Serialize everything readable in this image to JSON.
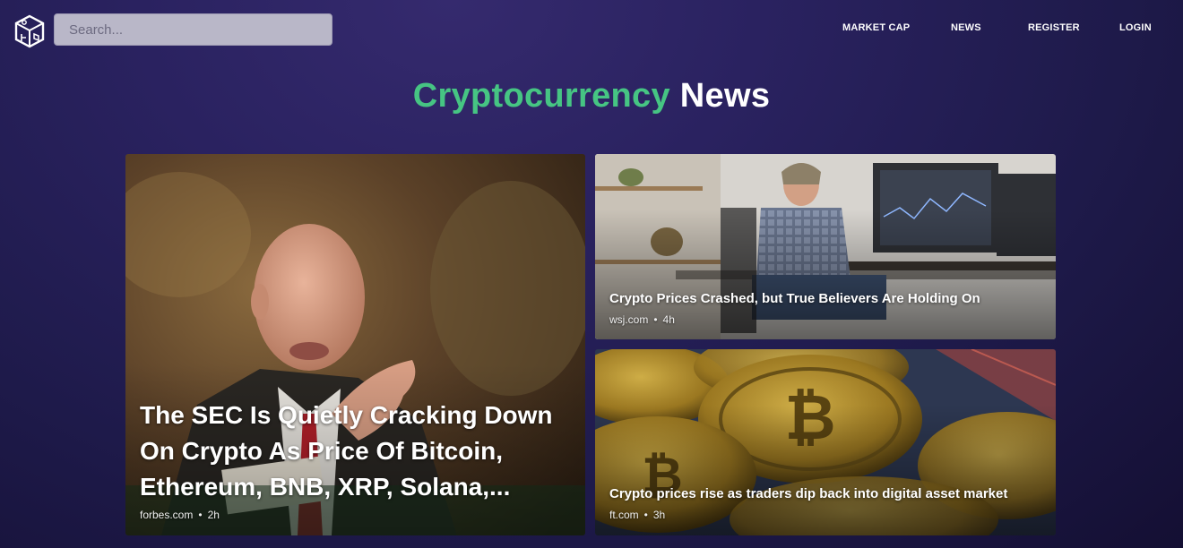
{
  "header": {
    "logo_icon": "cube-logo-icon",
    "search_placeholder": "Search...",
    "nav": [
      "MARKET CAP",
      "NEWS",
      "REGISTER",
      "LOGIN"
    ]
  },
  "page_title": {
    "accent": "Cryptocurrency",
    "rest": "News",
    "accent_color": "#46c583"
  },
  "articles": [
    {
      "headline": "The SEC Is Quietly Cracking Down On Crypto As Price Of Bitcoin, Ethereum, BNB, XRP, Solana,...",
      "source": "forbes.com",
      "age": "2h"
    },
    {
      "headline": "Crypto Prices Crashed, but True Believers Are Holding On",
      "source": "wsj.com",
      "age": "4h"
    },
    {
      "headline": "Crypto prices rise as traders dip back into digital asset market",
      "source": "ft.com",
      "age": "3h"
    }
  ]
}
